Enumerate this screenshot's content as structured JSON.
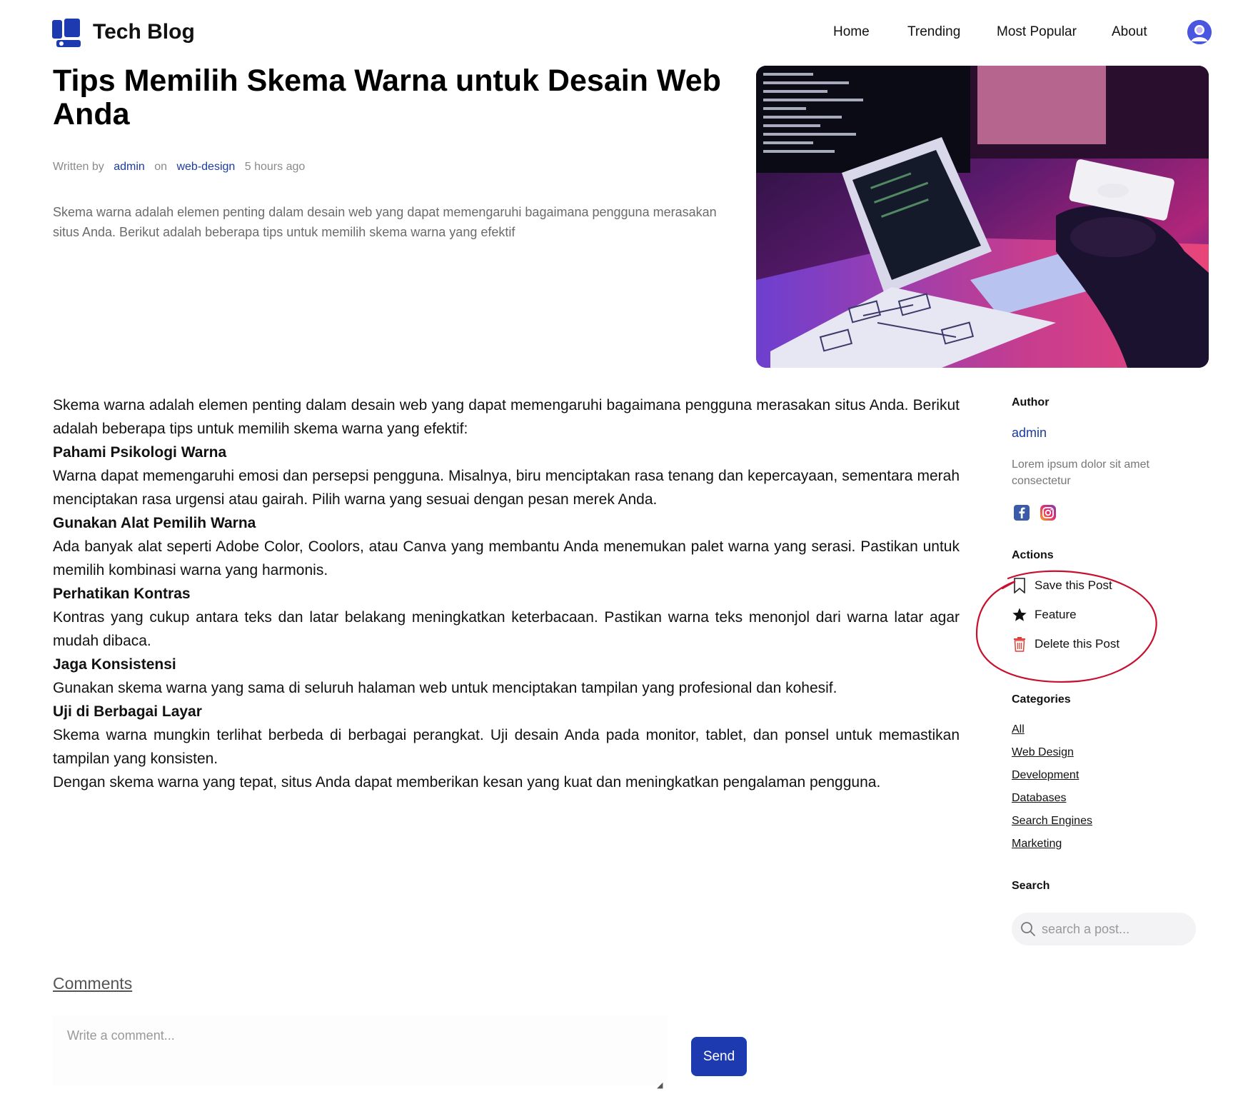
{
  "header": {
    "brand": "Tech Blog",
    "logo_icon": "blog-logo-icon",
    "nav": [
      "Home",
      "Trending",
      "Most Popular",
      "About"
    ],
    "avatar_icon": "user-avatar-icon"
  },
  "post": {
    "title": "Tips Memilih Skema Warna untuk Desain Web Anda",
    "meta": {
      "written_by": "Written by",
      "author": "admin",
      "on": "on",
      "category": "web-design",
      "time": "5 hours ago"
    },
    "excerpt": "Skema warna adalah elemen penting dalam desain web yang dapat memengaruhi bagaimana pengguna merasakan situs Anda. Berikut adalah beberapa tips untuk memilih skema warna yang efektif",
    "body": {
      "intro": "Skema warna adalah elemen penting dalam desain web yang dapat memengaruhi bagaimana pengguna merasakan situs Anda. Berikut adalah beberapa tips untuk memilih skema warna yang efektif:",
      "sections": [
        {
          "heading": "Pahami Psikologi Warna",
          "text": "Warna dapat memengaruhi emosi dan persepsi pengguna. Misalnya, biru menciptakan rasa tenang dan kepercayaan, sementara merah menciptakan rasa urgensi atau gairah. Pilih warna yang sesuai dengan pesan merek Anda."
        },
        {
          "heading": "Gunakan Alat Pemilih Warna",
          "text": "Ada banyak alat seperti Adobe Color, Coolors, atau Canva yang membantu Anda menemukan palet warna yang serasi. Pastikan untuk memilih kombinasi warna yang harmonis."
        },
        {
          "heading": "Perhatikan Kontras",
          "text": "Kontras yang cukup antara teks dan latar belakang meningkatkan keterbacaan. Pastikan warna teks menonjol dari warna latar agar mudah dibaca."
        },
        {
          "heading": "Jaga Konsistensi",
          "text": "Gunakan skema warna yang sama di seluruh halaman web untuk menciptakan tampilan yang profesional dan kohesif."
        },
        {
          "heading": "Uji di Berbagai Layar",
          "text": "Skema warna mungkin terlihat berbeda di berbagai perangkat. Uji desain Anda pada monitor, tablet, dan ponsel untuk memastikan tampilan yang konsisten."
        }
      ],
      "outro": "Dengan skema warna yang tepat, situs Anda dapat memberikan kesan yang kuat dan meningkatkan pengalaman pengguna."
    }
  },
  "sidebar": {
    "author_heading": "Author",
    "author_name": "admin",
    "author_bio": "Lorem ipsum dolor sit amet consectetur",
    "social_icons": [
      "facebook-icon",
      "instagram-icon"
    ],
    "actions_heading": "Actions",
    "actions": [
      {
        "label": "Save this Post",
        "icon": "bookmark-icon"
      },
      {
        "label": "Feature",
        "icon": "star-icon"
      },
      {
        "label": "Delete this Post",
        "icon": "trash-icon"
      }
    ],
    "categories_heading": "Categories",
    "categories": [
      "All",
      "Web Design",
      "Development",
      "Databases",
      "Search Engines",
      "Marketing"
    ],
    "search_heading": "Search",
    "search_placeholder": "search a post..."
  },
  "comments": {
    "title": "Comments",
    "placeholder": "Write a comment...",
    "send_label": "Send"
  },
  "colors": {
    "link": "#1c3a9e",
    "button": "#1d3ab0",
    "annotation": "#c8102e",
    "trash": "#e0403a"
  }
}
